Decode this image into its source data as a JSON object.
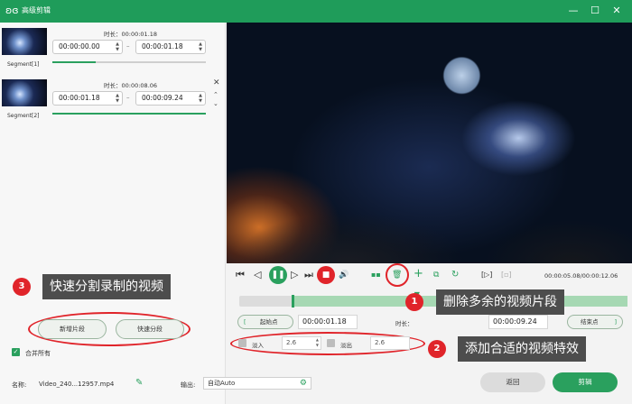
{
  "window": {
    "title": "高级剪辑",
    "logo_glyph": "ʚɞ",
    "minimize_glyph": "—",
    "maximize_glyph": "☐",
    "close_glyph": "✕",
    "accent_color": "#1f9c5a"
  },
  "segments": [
    {
      "name": "Segment[1]",
      "duration_label": "时长：00:00:01.18",
      "start": "00:00:00.00",
      "end": "00:00:01.18",
      "progress": 0.28
    },
    {
      "name": "Segment[2]",
      "duration_label": "时长：00:00:08.06",
      "start": "00:00:01.18",
      "end": "00:00:09.24",
      "progress": 1.0
    }
  ],
  "annotations": {
    "a1": {
      "num": "1",
      "text": "删除多余的视频片段"
    },
    "a2": {
      "num": "2",
      "text": "添加合适的视频特效"
    },
    "a3": {
      "num": "3",
      "text": "快速分割录制的视频"
    },
    "color": "#e0242a"
  },
  "left_actions": {
    "new_segment": "新增片段",
    "quick_split": "快速分段",
    "merge_all": "合并所有",
    "merge_checked": true
  },
  "playback": {
    "time_display": "00:00:05.08/00:00:12.06",
    "prev_icon": "⏮",
    "rewind_icon": "◁",
    "play_icon": "❚❚",
    "forward_icon": "▷",
    "next_icon": "⏭",
    "stop_icon": "■",
    "volume_icon": "🔊",
    "split_icon": "▪▪",
    "delete_icon": "🗑",
    "add_icon": "+",
    "copy_icon": "⧉",
    "reset_icon": "↻",
    "fit_icon": "[▷]",
    "crop_icon": "[▫]",
    "playhead_position": 0.46
  },
  "trim": {
    "start_label": "起始点",
    "start_value": "00:00:01.18",
    "duration_label": "时长：",
    "end_value": "00:00:09.24",
    "end_label": "结束点"
  },
  "effects": {
    "fade_in_label": "淡入",
    "fade_in_value": "2.6",
    "fade_out_label": "淡出",
    "fade_out_value": "2.6"
  },
  "footer": {
    "name_label": "名称:",
    "file_name": "Video_240...12957.mp4",
    "output_label": "输出:",
    "output_value": "自动Auto",
    "back_button": "返回",
    "edit_button": "剪辑"
  }
}
